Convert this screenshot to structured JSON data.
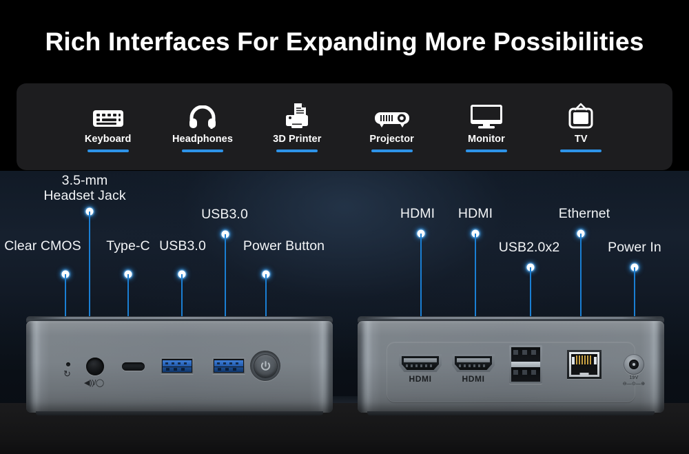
{
  "title": "Rich Interfaces For Expanding More Possibilities",
  "accent_color": "#2d93e8",
  "leader_color": "#1a7fd4",
  "compatible_devices": [
    {
      "label": "Keyboard",
      "icon": "keyboard-icon"
    },
    {
      "label": "Headphones",
      "icon": "headphones-icon"
    },
    {
      "label": "3D Printer",
      "icon": "printer-icon"
    },
    {
      "label": "Projector",
      "icon": "projector-icon"
    },
    {
      "label": "Monitor",
      "icon": "monitor-icon"
    },
    {
      "label": "TV",
      "icon": "tv-icon"
    }
  ],
  "front_panel": {
    "callouts": [
      {
        "label": "Clear CMOS"
      },
      {
        "label": "3.5-mm\nHeadset Jack"
      },
      {
        "label": "Type-C"
      },
      {
        "label": "USB3.0"
      },
      {
        "label": "USB3.0"
      },
      {
        "label": "Power Button"
      }
    ]
  },
  "rear_panel": {
    "callouts": [
      {
        "label": "HDMI"
      },
      {
        "label": "HDMI"
      },
      {
        "label": "USB2.0x2"
      },
      {
        "label": "Ethernet"
      },
      {
        "label": "Power In"
      }
    ],
    "port_marks": {
      "hdmi_1": "HDMI",
      "hdmi_2": "HDMI",
      "dc_voltage": "19V",
      "dc_polarity": "⊖—⊙—⊕"
    }
  },
  "front_port_marks": {
    "cmos_glyph": "↻",
    "audio_glyph": "◀))/◯"
  }
}
